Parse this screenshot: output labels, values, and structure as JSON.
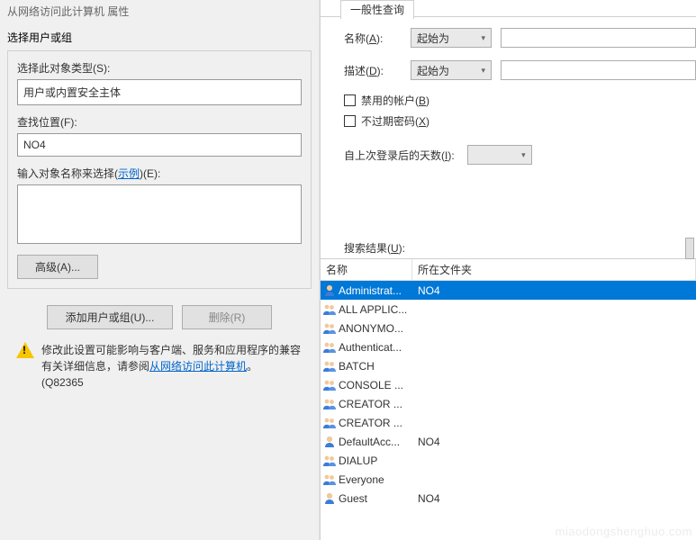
{
  "left": {
    "title": "从网络访问此计算机 属性",
    "groupbox_title": "选择用户或组",
    "object_type_label": "选择此对象类型(S):",
    "object_type_value": "用户或内置安全主体",
    "location_label": "查找位置(F):",
    "location_value": "NO4",
    "names_label_prefix": "输入对象名称来选择(",
    "names_label_link": "示例",
    "names_label_suffix": ")(E):",
    "advanced_btn": "高级(A)...",
    "add_btn": "添加用户或组(U)...",
    "remove_btn": "删除(R)",
    "warn_line1": "修改此设置可能影响与客户端、服务和应用程序的兼容",
    "warn_line2_prefix": "有关详细信息，请参阅",
    "warn_link": "从网络访问此计算机",
    "warn_line2_suffix": "。 (Q82365"
  },
  "right": {
    "tab_label": "一般性查询",
    "name_label": "名称(A):",
    "desc_label": "描述(D):",
    "starts_with": "起始为",
    "chk_disabled": "禁用的帐户(B)",
    "chk_nonexpire": "不过期密码(X)",
    "days_label": "自上次登录后的天数(I):",
    "results_label": "搜索结果(U):",
    "columns": {
      "name": "名称",
      "folder": "所在文件夹"
    },
    "rows": [
      {
        "icon": "user",
        "name": "Administrat...",
        "folder": "NO4",
        "selected": true
      },
      {
        "icon": "group",
        "name": "ALL APPLIC...",
        "folder": ""
      },
      {
        "icon": "group",
        "name": "ANONYMO...",
        "folder": ""
      },
      {
        "icon": "group",
        "name": "Authenticat...",
        "folder": ""
      },
      {
        "icon": "group",
        "name": "BATCH",
        "folder": ""
      },
      {
        "icon": "group",
        "name": "CONSOLE ...",
        "folder": ""
      },
      {
        "icon": "group",
        "name": "CREATOR ...",
        "folder": ""
      },
      {
        "icon": "group",
        "name": "CREATOR ...",
        "folder": ""
      },
      {
        "icon": "user",
        "name": "DefaultAcc...",
        "folder": "NO4"
      },
      {
        "icon": "group",
        "name": "DIALUP",
        "folder": ""
      },
      {
        "icon": "group",
        "name": "Everyone",
        "folder": ""
      },
      {
        "icon": "user",
        "name": "Guest",
        "folder": "NO4"
      }
    ]
  },
  "watermark": "miaodongshenghuo.com"
}
